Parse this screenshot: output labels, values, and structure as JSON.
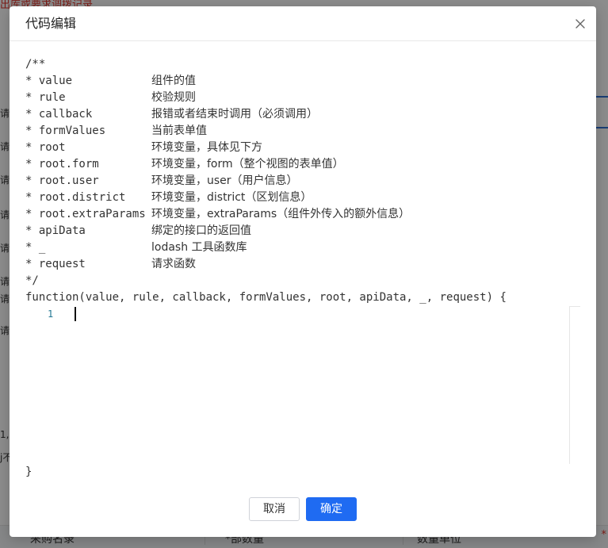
{
  "background": {
    "top_notice": "出库或要求调拨记录",
    "side_labels": [
      "请输",
      "请输",
      "请输",
      "请输",
      "请输",
      "请输",
      "请输",
      "请输"
    ],
    "side_fragments": [
      "1,",
      "j不"
    ],
    "bottom_cells": [
      "采购名录",
      "*部数量",
      "数量单位"
    ],
    "required_mark": "*"
  },
  "modal": {
    "title": "代码编辑",
    "close_icon": "close-icon",
    "doc_open": "/**",
    "doc_params": [
      {
        "param": "* value",
        "desc": "组件的值"
      },
      {
        "param": "* rule",
        "desc": "校验规则"
      },
      {
        "param": "* callback",
        "desc": "报错或者结束时调用（必须调用）"
      },
      {
        "param": "* formValues",
        "desc": "当前表单值"
      },
      {
        "param": "* root",
        "desc": "环境变量，具体见下方"
      },
      {
        "param": "* root.form",
        "desc": "环境变量，form（整个视图的表单值）"
      },
      {
        "param": "* root.user",
        "desc": "环境变量，user（用户信息）"
      },
      {
        "param": "* root.district",
        "desc": "环境变量，district（区划信息）"
      },
      {
        "param": "* root.extraParams",
        "desc": "环境变量，extraParams（组件外传入的额外信息）"
      },
      {
        "param": "* apiData",
        "desc": "绑定的接口的返回值"
      },
      {
        "param": "* _",
        "desc": "lodash 工具函数库"
      },
      {
        "param": "* request",
        "desc": "请求函数"
      }
    ],
    "doc_close": "*/",
    "signature": "function(value, rule, callback, formValues, root, apiData, _, request) {",
    "editor": {
      "line_number": "1",
      "content": ""
    },
    "closing_brace": "}",
    "cancel_label": "取消",
    "ok_label": "确定",
    "accent_color": "#1f6bf2"
  }
}
